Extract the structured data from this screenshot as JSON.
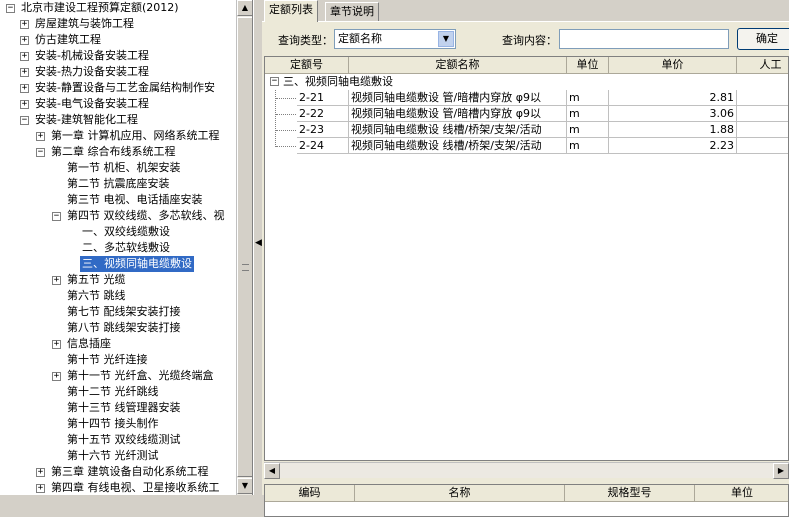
{
  "tree": {
    "rows": [
      {
        "label": "北京市建设工程预算定额(2012)",
        "expander": "⊟",
        "level": 0
      },
      {
        "label": "房屋建筑与装饰工程",
        "expander": "⊞",
        "level": 1
      },
      {
        "label": "仿古建筑工程",
        "expander": "⊞",
        "level": 1
      },
      {
        "label": "安装-机械设备安装工程",
        "expander": "⊞",
        "level": 1
      },
      {
        "label": "安装-热力设备安装工程",
        "expander": "⊞",
        "level": 1
      },
      {
        "label": "安装-静置设备与工艺金属结构制作安",
        "expander": "⊞",
        "level": 1
      },
      {
        "label": "安装-电气设备安装工程",
        "expander": "⊞",
        "level": 1
      },
      {
        "label": "安装-建筑智能化工程",
        "expander": "⊟",
        "level": 1
      },
      {
        "label": "第一章 计算机应用、网络系统工程",
        "expander": "⊞",
        "level": 2
      },
      {
        "label": "第二章 综合布线系统工程",
        "expander": "⊟",
        "level": 2
      },
      {
        "label": "第一节 机柜、机架安装",
        "expander": "",
        "level": 3
      },
      {
        "label": "第二节 抗震底座安装",
        "expander": "",
        "level": 3
      },
      {
        "label": "第三节 电视、电话插座安装",
        "expander": "",
        "level": 3
      },
      {
        "label": "第四节 双绞线缆、多芯软线、视",
        "expander": "⊟",
        "level": 3
      },
      {
        "label": "一、双绞线缆敷设",
        "expander": "",
        "level": 4
      },
      {
        "label": "二、多芯软线敷设",
        "expander": "",
        "level": 4
      },
      {
        "label": "三、视频同轴电缆敷设",
        "expander": "",
        "level": 4,
        "selected": true
      },
      {
        "label": "第五节 光缆",
        "expander": "⊞",
        "level": 3
      },
      {
        "label": "第六节 跳线",
        "expander": "",
        "level": 3
      },
      {
        "label": "第七节 配线架安装打接",
        "expander": "",
        "level": 3
      },
      {
        "label": "第八节 跳线架安装打接",
        "expander": "",
        "level": 3
      },
      {
        "label": "信息插座",
        "expander": "⊞",
        "level": 3
      },
      {
        "label": "第十节 光纤连接",
        "expander": "",
        "level": 3
      },
      {
        "label": "第十一节 光纤盒、光缆终端盒",
        "expander": "⊞",
        "level": 3
      },
      {
        "label": "第十二节 光纤跳线",
        "expander": "",
        "level": 3
      },
      {
        "label": "第十三节 线管理器安装",
        "expander": "",
        "level": 3
      },
      {
        "label": "第十四节 接头制作",
        "expander": "",
        "level": 3
      },
      {
        "label": "第十五节 双绞线缆测试",
        "expander": "",
        "level": 3
      },
      {
        "label": "第十六节 光纤测试",
        "expander": "",
        "level": 3
      },
      {
        "label": "第三章 建筑设备自动化系统工程",
        "expander": "⊞",
        "level": 2
      },
      {
        "label": "第四章 有线电视、卫星接收系统工",
        "expander": "⊞",
        "level": 2
      }
    ]
  },
  "tabs": [
    {
      "label": "定额列表",
      "active": true
    },
    {
      "label": "章节说明",
      "active": false
    }
  ],
  "query": {
    "type_label": "查询类型：",
    "type_value": "定额名称",
    "content_label": "查询内容：",
    "content_value": "",
    "button_label": "确定"
  },
  "grid": {
    "headers": [
      "定额号",
      "定额名称",
      "单位",
      "单价",
      "人工"
    ],
    "group_label": "三、视频同轴电缆敷设",
    "rows": [
      {
        "code": "2-21",
        "name": "视频同轴电缆敷设 管/暗槽内穿放 φ9以",
        "unit": "m",
        "price": "2.81"
      },
      {
        "code": "2-22",
        "name": "视频同轴电缆敷设 管/暗槽内穿放 φ9以",
        "unit": "m",
        "price": "3.06"
      },
      {
        "code": "2-23",
        "name": "视频同轴电缆敷设 线槽/桥架/支架/活动",
        "unit": "m",
        "price": "1.88"
      },
      {
        "code": "2-24",
        "name": "视频同轴电缆敷设 线槽/桥架/支架/活动",
        "unit": "m",
        "price": "2.23"
      }
    ]
  },
  "bottom_grid": {
    "headers": [
      "编码",
      "名称",
      "规格型号",
      "单位"
    ]
  },
  "icons": {
    "collapse": "minus-box-icon",
    "expand": "plus-box-icon",
    "scroll_up": "scroll-up-arrow-icon",
    "scroll_down": "scroll-down-arrow-icon",
    "dropdown": "dropdown-arrow-icon",
    "splitter": "splitter-arrow-icon"
  },
  "colors": {
    "selection": "#316ac5",
    "panel": "#ece9d8",
    "border": "#808080"
  }
}
